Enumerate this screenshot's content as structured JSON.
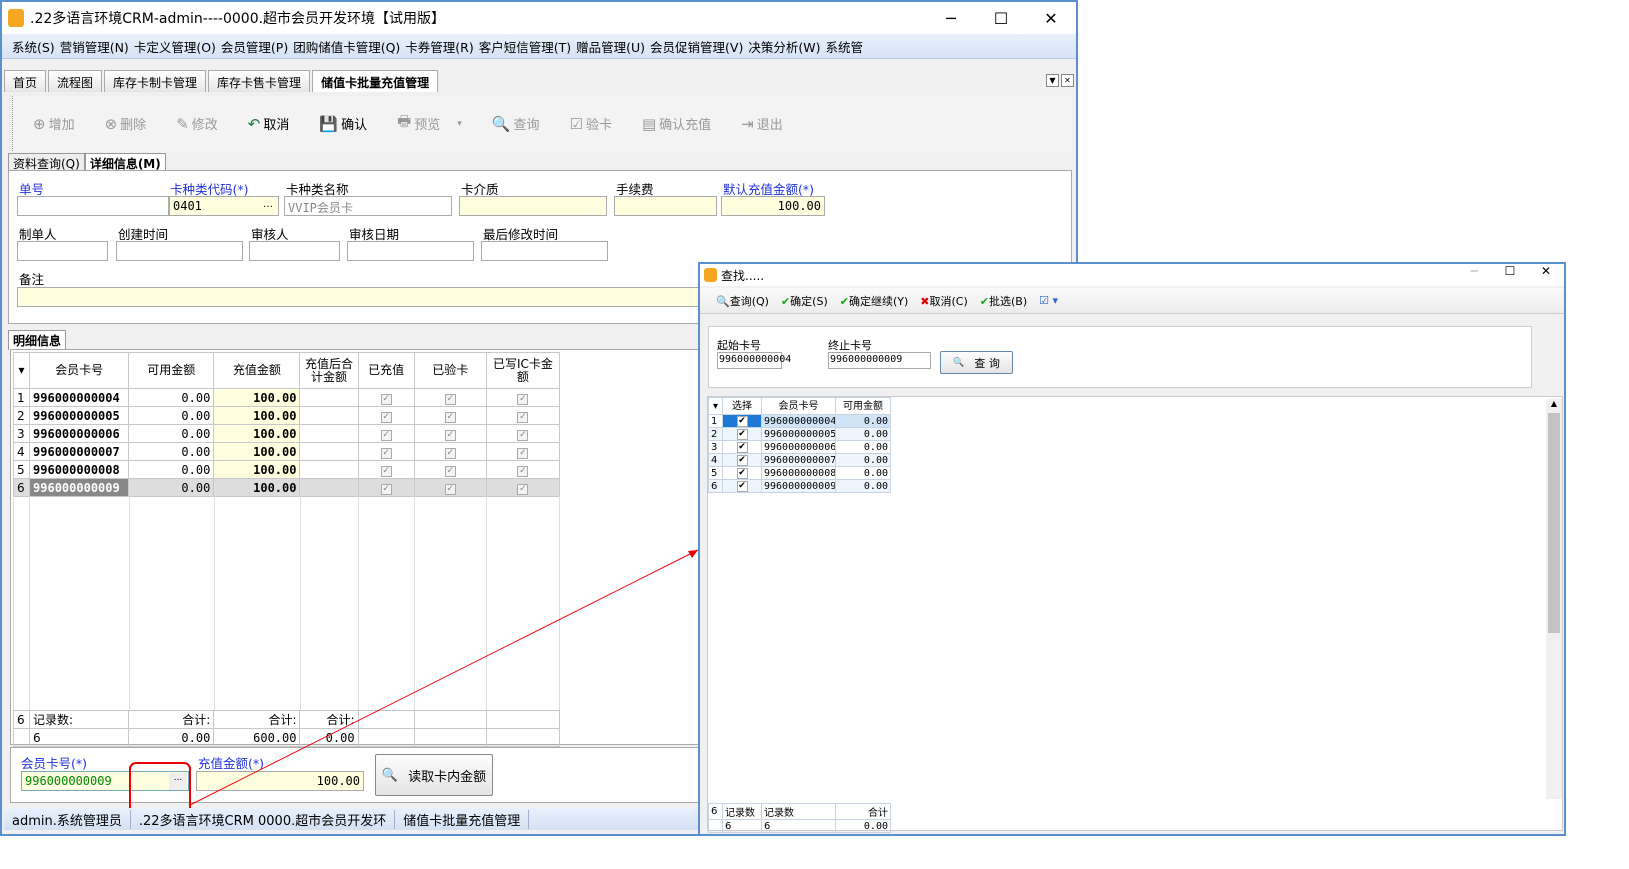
{
  "window": {
    "title": ".22多语言环境CRM-admin----0000.超市会员开发环境【试用版】",
    "minimize": "─",
    "maximize": "☐",
    "close": "✕"
  },
  "menu": [
    "系统(S)",
    "营销管理(N)",
    "卡定义管理(O)",
    "会员管理(P)",
    "团购储值卡管理(Q)",
    "卡券管理(R)",
    "客户短信管理(T)",
    "赠品管理(U)",
    "会员促销管理(V)",
    "决策分析(W)",
    "系统管"
  ],
  "tabs": [
    "首页",
    "流程图",
    "库存卡制卡管理",
    "库存卡售卡管理",
    "储值卡批量充值管理"
  ],
  "toolbar": [
    "增加",
    "删除",
    "修改",
    "取消",
    "确认",
    "预览",
    "查询",
    "验卡",
    "确认充值",
    "退出"
  ],
  "subtabs": [
    "资料查询(Q)",
    "详细信息(M)"
  ],
  "form": {
    "danhao_label": "单号",
    "danhao": "",
    "cardtype_code_label": "卡种类代码(*)",
    "cardtype_code": "0401",
    "cardtype_name_label": "卡种类名称",
    "cardtype_name": "VVIP会员卡",
    "medium_label": "卡介质",
    "fee_label": "手续费",
    "default_amount_label": "默认充值金额(*)",
    "default_amount": "100.00",
    "maker_label": "制单人",
    "created_label": "创建时间",
    "auditor_label": "审核人",
    "audit_date_label": "审核日期",
    "modified_label": "最后修改时间",
    "remark_label": "备注"
  },
  "detail_tab": "明细信息",
  "grid": {
    "headers": [
      "会员卡号",
      "可用金额",
      "充值金额",
      "充值后合计金额",
      "已充值",
      "已验卡",
      "已写IC卡金额"
    ],
    "rows": [
      {
        "no": "1",
        "card": "996000000004",
        "avail": "0.00",
        "amount": "100.00"
      },
      {
        "no": "2",
        "card": "996000000005",
        "avail": "0.00",
        "amount": "100.00"
      },
      {
        "no": "3",
        "card": "996000000006",
        "avail": "0.00",
        "amount": "100.00"
      },
      {
        "no": "4",
        "card": "996000000007",
        "avail": "0.00",
        "amount": "100.00"
      },
      {
        "no": "5",
        "card": "996000000008",
        "avail": "0.00",
        "amount": "100.00"
      },
      {
        "no": "6",
        "card": "996000000009",
        "avail": "0.00",
        "amount": "100.00"
      }
    ],
    "footer": {
      "count": "6",
      "count_label": "记录数:",
      "sum_label": "合计:",
      "count_value": "6",
      "avail_sum": "0.00",
      "amount_sum": "600.00",
      "after_sum": "0.00"
    }
  },
  "bottom": {
    "card_label": "会员卡号(*)",
    "card": "996000000009",
    "amount_label": "充值金额(*)",
    "amount": "100.00",
    "read_button": "读取卡内金额",
    "ellipsis": "..."
  },
  "status": [
    "admin.系统管理员",
    ".22多语言环境CRM 0000.超市会员开发环",
    "储值卡批量充值管理"
  ],
  "dialog": {
    "title": "查找.....",
    "toolbar": [
      "查询(Q)",
      "确定(S)",
      "确定继续(Y)",
      "取消(C)",
      "批选(B)"
    ],
    "start_label": "起始卡号",
    "start": "996000000004",
    "end_label": "终止卡号",
    "end": "996000000009",
    "query_button": "查 询",
    "headers": [
      "选择",
      "会员卡号",
      "可用金额"
    ],
    "rows": [
      {
        "no": "1",
        "card": "996000000004",
        "avail": "0.00"
      },
      {
        "no": "2",
        "card": "996000000005",
        "avail": "0.00"
      },
      {
        "no": "3",
        "card": "996000000006",
        "avail": "0.00"
      },
      {
        "no": "4",
        "card": "996000000007",
        "avail": "0.00"
      },
      {
        "no": "5",
        "card": "996000000008",
        "avail": "0.00"
      },
      {
        "no": "6",
        "card": "996000000009",
        "avail": "0.00"
      }
    ],
    "footer": {
      "count": "6",
      "label1": "记录数",
      "label2": "记录数",
      "sum_label": "合计",
      "v1": "6",
      "v2": "6",
      "sum": "0.00"
    }
  }
}
